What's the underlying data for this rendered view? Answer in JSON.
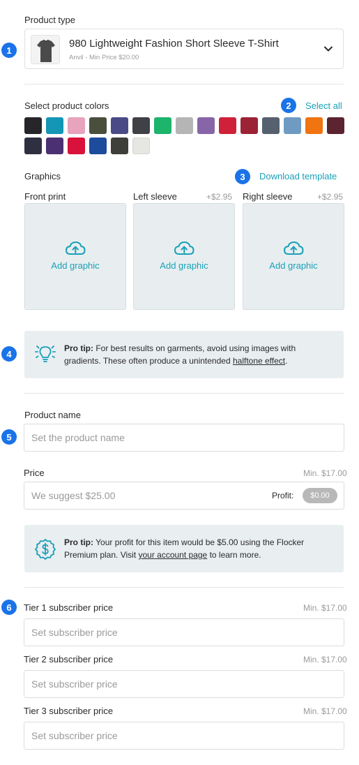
{
  "product_type": {
    "label": "Product type",
    "title": "980 Lightweight Fashion Short Sleeve T-Shirt",
    "subtitle": "Anvil - Min Price $20.00",
    "step": "1"
  },
  "colors": {
    "label": "Select product colors",
    "select_all": "Select all",
    "step": "2",
    "swatches": [
      "#26262a",
      "#1496b5",
      "#e8a3bd",
      "#4a4f3d",
      "#4a4a86",
      "#3f4146",
      "#1db46b",
      "#b5b5b5",
      "#8766a8",
      "#cf2138",
      "#9c2235",
      "#56606e",
      "#6f9bc2",
      "#f07410",
      "#5c2330",
      "#2e3042",
      "#4b3073",
      "#d8123a",
      "#1e4c9c",
      "#3e3e3a",
      "#e6e6e2"
    ]
  },
  "graphics": {
    "label": "Graphics",
    "download": "Download template",
    "step": "3",
    "front": {
      "label": "Front print",
      "add": "Add graphic"
    },
    "left": {
      "label": "Left sleeve",
      "price": "+$2.95",
      "add": "Add graphic"
    },
    "right": {
      "label": "Right sleeve",
      "price": "+$2.95",
      "add": "Add graphic"
    }
  },
  "tip1": {
    "step": "4",
    "bold": "Pro tip:",
    "text": " For best results on garments, avoid using images with gradients. These often produce a unintended ",
    "link": "halftone effect",
    "end": "."
  },
  "product_name": {
    "label": "Product name",
    "placeholder": "Set the product name",
    "step": "5"
  },
  "price": {
    "label": "Price",
    "min": "Min. $17.00",
    "placeholder": "We suggest $25.00",
    "profit_label": "Profit:",
    "profit_value": "$0.00"
  },
  "tip2": {
    "bold": "Pro tip:",
    "text": " Your profit for this item would be $5.00 using the Flocker Premium plan. Visit ",
    "link": "your account page",
    "end": " to learn more."
  },
  "tiers": {
    "step": "6",
    "tier1": {
      "label": "Tier 1 subscriber price",
      "min": "Min. $17.00",
      "placeholder": "Set subscriber price"
    },
    "tier2": {
      "label": "Tier 2 subscriber price",
      "min": "Min. $17.00",
      "placeholder": "Set subscriber price"
    },
    "tier3": {
      "label": "Tier 3 subscriber price",
      "min": "Min. $17.00",
      "placeholder": "Set subscriber price"
    }
  }
}
